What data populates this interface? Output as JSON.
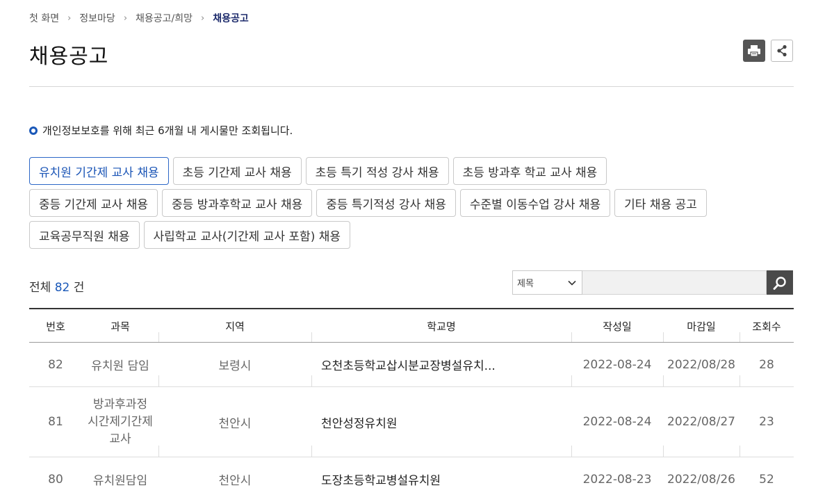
{
  "breadcrumb": {
    "items": [
      "첫 화면",
      "정보마당",
      "채용공고/희망"
    ],
    "current": "채용공고"
  },
  "page": {
    "title": "채용공고"
  },
  "notice": {
    "text": "개인정보보호를 위해 최근 6개월 내 게시물만 조회됩니다."
  },
  "categories": {
    "row1": [
      "유치원 기간제 교사 채용",
      "초등 기간제 교사 채용",
      "초등 특기 적성 강사 채용",
      "초등 방과후 학교 교사 채용"
    ],
    "row2": [
      "중등 기간제 교사 채용",
      "중등 방과후학교 교사 채용",
      "중등 특기적성 강사 채용",
      "수준별 이동수업 강사 채용",
      "기타 채용 공고"
    ],
    "row3": [
      "교육공무직원 채용",
      "사립학교 교사(기간제 교사 포함) 채용"
    ],
    "active": "유치원 기간제 교사 채용"
  },
  "total": {
    "prefix": "전체",
    "count": "82",
    "suffix": "건"
  },
  "search": {
    "select_value": "제목",
    "input_value": ""
  },
  "table": {
    "headers": [
      "번호",
      "과목",
      "지역",
      "학교명",
      "작성일",
      "마감일",
      "조회수"
    ],
    "rows": [
      {
        "no": "82",
        "subject": "유치원 담임",
        "region": "보령시",
        "school": "오천초등학교삽시분교장병설유치...",
        "written": "2022-08-24",
        "deadline": "2022/08/28",
        "views": "28"
      },
      {
        "no": "81",
        "subject": "방과후과정 시간제기간제교사",
        "region": "천안시",
        "school": "천안성정유치원",
        "written": "2022-08-24",
        "deadline": "2022/08/27",
        "views": "23"
      },
      {
        "no": "80",
        "subject": "유치원담임",
        "region": "천안시",
        "school": "도장초등학교병설유치원",
        "written": "2022-08-23",
        "deadline": "2022/08/26",
        "views": "52"
      }
    ]
  }
}
